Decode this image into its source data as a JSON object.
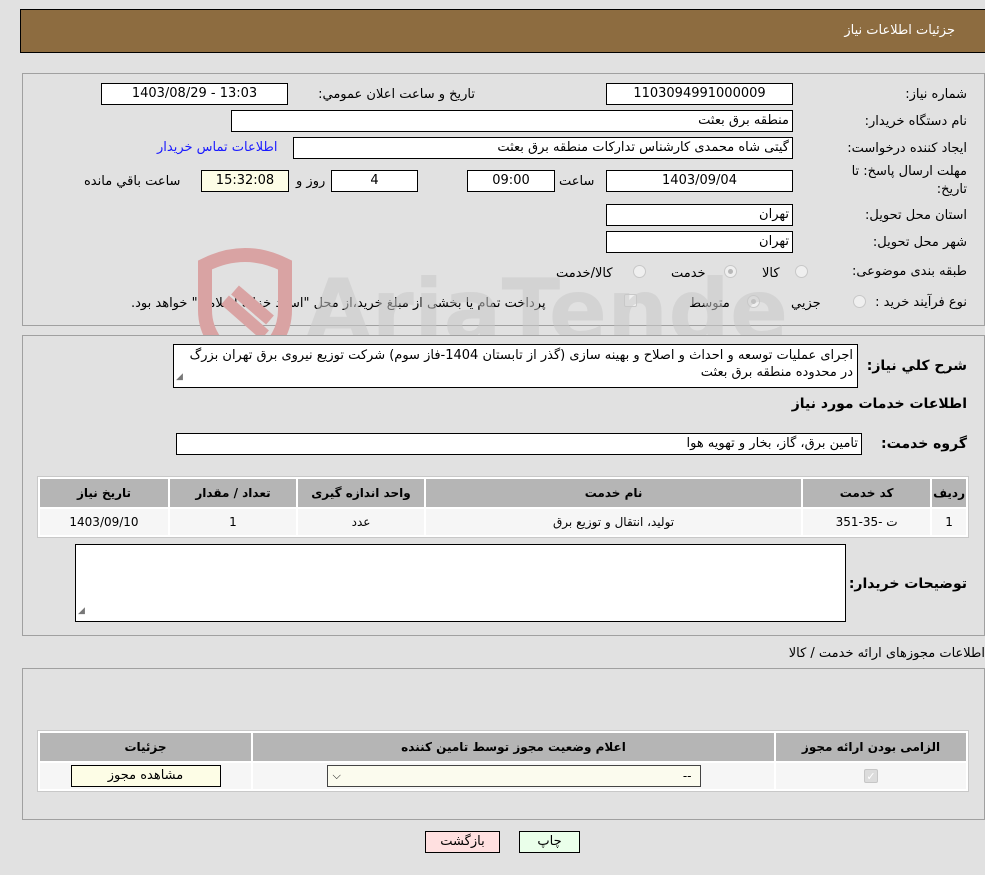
{
  "header": {
    "title": "جزئیات اطلاعات نیاز"
  },
  "form": {
    "need_number_label": "شماره نیاز:",
    "need_number": "1103094991000009",
    "announce_label": "تاریخ و ساعت اعلان عمومي:",
    "announce_value": "1403/08/29 - 13:03",
    "buyer_org_label": "نام دستگاه خریدار:",
    "buyer_org": "منطقه برق بعثت",
    "creator_label": "ایجاد کننده درخواست:",
    "creator": "گیتی شاه محمدی کارشناس تدارکات منطقه برق بعثت",
    "buyer_contact_link": "اطلاعات تماس خریدار",
    "deadline_label_line1": "مهلت ارسال پاسخ: تا",
    "deadline_label_line2": "تاریخ:",
    "deadline_date": "1403/09/04",
    "time_label": "ساعت",
    "deadline_time": "09:00",
    "days_value": "4",
    "days_label": "روز و",
    "remaining_time": "15:32:08",
    "remaining_label": "ساعت باقي مانده",
    "province_label": "استان محل تحویل:",
    "province": "تهران",
    "city_label": "شهر محل تحویل:",
    "city": "تهران",
    "category_label": "طبقه بندی موضوعی:",
    "category_options": [
      {
        "label": "کالا",
        "selected": false
      },
      {
        "label": "خدمت",
        "selected": true
      },
      {
        "label": "کالا/خدمت",
        "selected": false
      }
    ],
    "purchase_type_label": "نوع فرآیند خرید :",
    "purchase_type_options": [
      {
        "label": "جزيي",
        "selected": false
      },
      {
        "label": "متوسط",
        "selected": true
      }
    ],
    "treasury_checkbox_label": "پرداخت تمام یا بخشی از مبلغ خرید،از محل \"اسناد خزانه اسلامی\" خواهد بود.",
    "treasury_checked": false
  },
  "description": {
    "label": "شرح کلي نیاز:",
    "text": "اجرای عملیات توسعه و احداث و اصلاح و بهینه سازی (گذر از تابستان 1404-فاز سوم) شرکت توزیع نیروی برق تهران بزرگ در محدوده منطقه برق بعثت"
  },
  "services": {
    "section_title": "اطلاعات خدمات مورد نیاز",
    "group_label": "گروه خدمت:",
    "group_value": "تامین برق، گاز، بخار و تهویه هوا",
    "columns": [
      "ردیف",
      "کد خدمت",
      "نام خدمت",
      "واحد اندازه گیری",
      "تعداد / مقدار",
      "تاریخ نیاز"
    ],
    "rows": [
      [
        "1",
        "ت -35-351",
        "تولید، انتقال و توزیع برق",
        "عدد",
        "1",
        "1403/09/10"
      ]
    ]
  },
  "buyer_notes": {
    "label": "توضیحات خریدار:",
    "text": ""
  },
  "permits": {
    "section_title": "اطلاعات مجوزهای ارائه خدمت / کالا",
    "columns": [
      "الزامی بودن ارائه مجوز",
      "اعلام وضعیت مجوز توسط تامین کننده",
      "جزئیات"
    ],
    "rows": [
      {
        "required_checked": true,
        "status_selected": "--",
        "details_button": "مشاهده مجوز"
      }
    ]
  },
  "footer": {
    "print_button": "چاپ",
    "back_button": "بازگشت"
  },
  "colors": {
    "header_bg": "#8d6c40",
    "back_button_bg": "#ffe0e0",
    "print_button_bg": "#eaffea",
    "link": "#1a1aff"
  },
  "watermark": {
    "text": "AriaTender.neT"
  }
}
